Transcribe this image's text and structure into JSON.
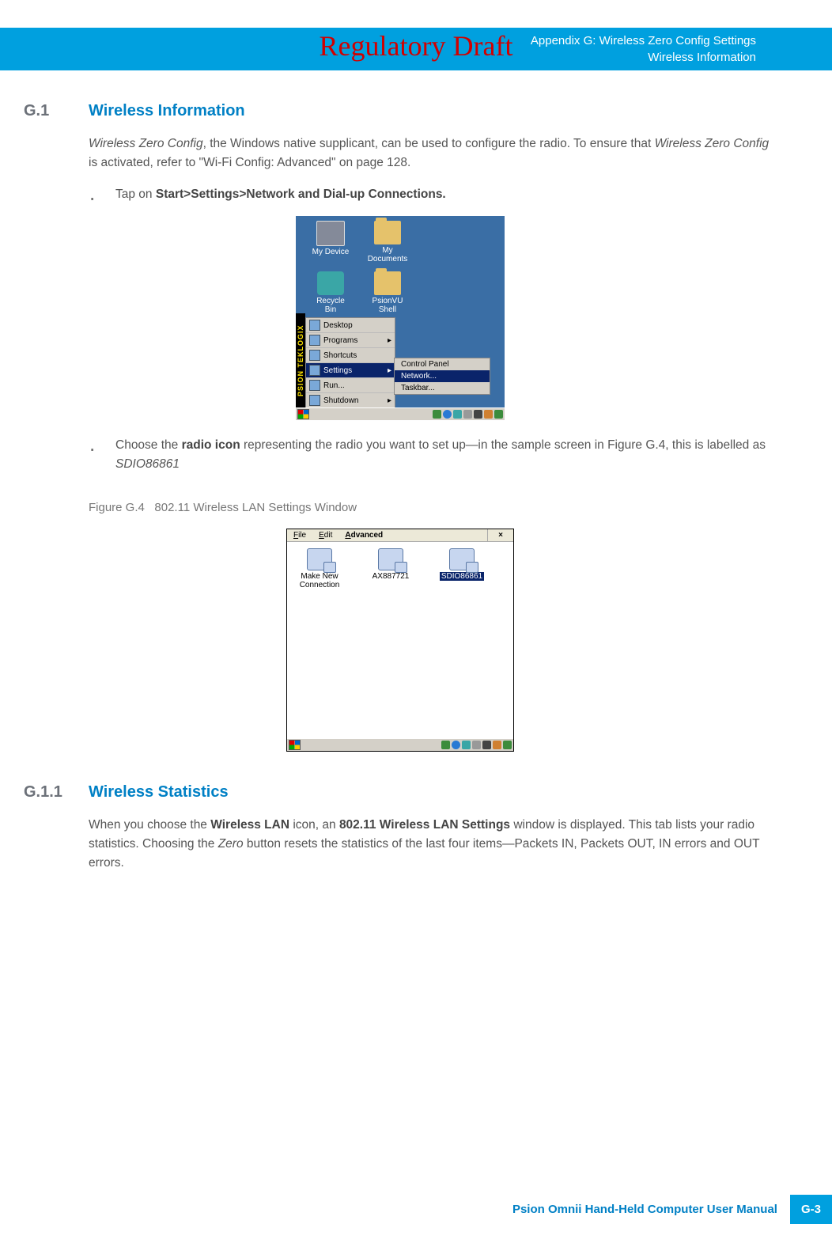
{
  "watermark": "Regulatory Draft",
  "header": {
    "line1": "Appendix G: Wireless Zero Config Settings",
    "line2": "Wireless Information"
  },
  "sections": {
    "g1": {
      "num": "G.1",
      "title": "Wireless Information",
      "para_pre_em1": "Wireless Zero Config",
      "para_mid1": ", the Windows native supplicant, can be used to configure the radio. To ensure that ",
      "para_em2": "Wireless Zero Config",
      "para_mid2": " is activated, refer to \"Wi-Fi Config: Advanced\" on page 128.",
      "bullet1_pre": "Tap on ",
      "bullet1_strong": "Start>Settings>Network and Dial-up Connections.",
      "bullet2_pre": "Choose the ",
      "bullet2_strong": "radio icon",
      "bullet2_mid": " representing the radio you want to set up—in the sample screen in Figure G.4, this is labelled as ",
      "bullet2_em": "SDIO86861"
    },
    "figcap": {
      "label": "Figure G.4",
      "text": "802.11 Wireless LAN Settings Window"
    },
    "g11": {
      "num": "G.1.1",
      "title": "Wireless Statistics",
      "p_pre": "When you choose the ",
      "p_s1": "Wireless LAN",
      "p_mid1": " icon, an ",
      "p_s2": "802.11 Wireless LAN Settings",
      "p_mid2": " window is displayed. This tab lists your radio statistics. Choosing the ",
      "p_em": "Zero",
      "p_post": " button resets the statistics of the last four items—Packets IN, Packets OUT, IN errors and OUT errors."
    }
  },
  "shot1": {
    "desk": [
      "My Device",
      "My Documents",
      "Recycle Bin",
      "PsionVU Shell"
    ],
    "sidebar": "PSION TEKLOGIX",
    "start": [
      "Desktop",
      "Programs",
      "Shortcuts",
      "Settings",
      "Run...",
      "Shutdown"
    ],
    "sub": [
      "Control Panel",
      "Network...",
      "Taskbar..."
    ]
  },
  "shot2": {
    "menu": {
      "file": "File",
      "edit": "Edit",
      "adv": "Advanced",
      "close": "×"
    },
    "icons": [
      "Make New Connection",
      "AX887721",
      "SDIO86861"
    ]
  },
  "footer": {
    "manual": "Psion Omnii Hand-Held Computer User Manual",
    "page": "G-3"
  }
}
